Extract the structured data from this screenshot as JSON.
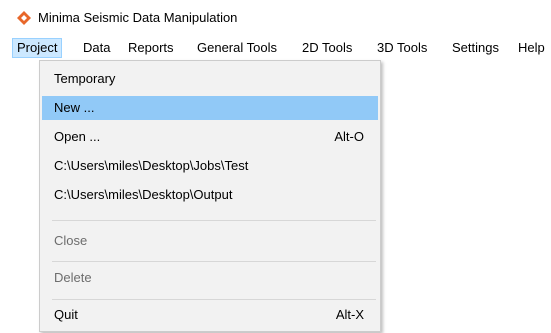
{
  "window": {
    "title": "Minima Seismic Data Manipulation",
    "icon": "minima-diamond-icon",
    "icon_color": "#e8672a"
  },
  "menubar": {
    "items": [
      {
        "label": "Project",
        "open": true
      },
      {
        "label": "Data"
      },
      {
        "label": "Reports"
      },
      {
        "label": "General Tools"
      },
      {
        "label": "2D Tools"
      },
      {
        "label": "3D Tools"
      },
      {
        "label": "Settings"
      },
      {
        "label": "Help"
      }
    ]
  },
  "project_menu": {
    "items": [
      {
        "label": "Temporary",
        "shortcut": "",
        "enabled": true,
        "highlighted": false
      },
      {
        "label": "New ...",
        "shortcut": "",
        "enabled": true,
        "highlighted": true
      },
      {
        "label": "Open ...",
        "shortcut": "Alt-O",
        "enabled": true,
        "highlighted": false
      },
      {
        "label": "C:\\Users\\miles\\Desktop\\Jobs\\Test",
        "shortcut": "",
        "enabled": true,
        "highlighted": false
      },
      {
        "label": "C:\\Users\\miles\\Desktop\\Output",
        "shortcut": "",
        "enabled": true,
        "highlighted": false
      },
      {
        "label": "Close",
        "shortcut": "",
        "enabled": false,
        "highlighted": false
      },
      {
        "label": "Delete",
        "shortcut": "",
        "enabled": false,
        "highlighted": false
      },
      {
        "label": "Quit",
        "shortcut": "Alt-X",
        "enabled": true,
        "highlighted": false
      }
    ]
  },
  "colors": {
    "menu_open_bg": "#cce8ff",
    "menu_highlight": "#91c9f7",
    "menu_bg": "#f2f2f2",
    "disabled_text": "#6d6d6d"
  }
}
